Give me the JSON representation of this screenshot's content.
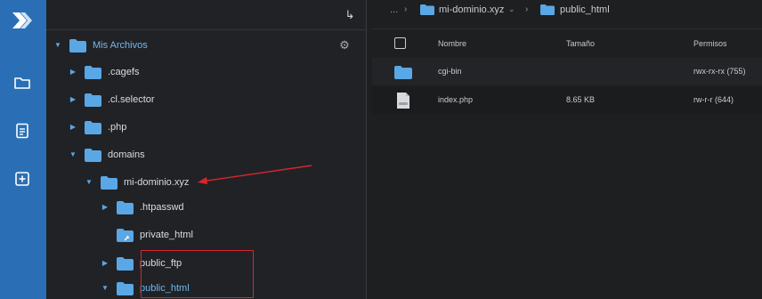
{
  "rail": {
    "items": [
      {
        "icon": "logo-icon"
      },
      {
        "icon": "folder-icon"
      },
      {
        "icon": "document-icon"
      },
      {
        "icon": "add-box-icon"
      }
    ]
  },
  "tree": {
    "collapse_icon": "collapse-arrow-icon",
    "root": {
      "label": "Mis Archivos"
    },
    "items": [
      {
        "label": ".cagefs"
      },
      {
        "label": ".cl.selector"
      },
      {
        "label": ".php"
      },
      {
        "label": "domains"
      },
      {
        "label": "mi-dominio.xyz"
      },
      {
        "label": ".htpasswd"
      },
      {
        "label": "private_html"
      },
      {
        "label": "public_ftp"
      },
      {
        "label": "public_html"
      }
    ]
  },
  "breadcrumb": {
    "ellipsis": "...",
    "crumbs": [
      {
        "label": "mi-dominio.xyz"
      },
      {
        "label": "public_html"
      }
    ]
  },
  "table": {
    "headers": {
      "name": "Nombre",
      "size": "Tamaño",
      "perms": "Permisos"
    },
    "rows": [
      {
        "name": "cgi-bin",
        "size": "",
        "perms": "rwx-rx-rx (755)",
        "type": "folder"
      },
      {
        "name": "index.php",
        "size": "8.65 KB",
        "perms": "rw-r-r (644)",
        "type": "file"
      }
    ]
  },
  "colors": {
    "accent_blue": "#2a6fb5",
    "folder_blue": "#5aa7e6",
    "highlight_red": "#d9262b"
  }
}
